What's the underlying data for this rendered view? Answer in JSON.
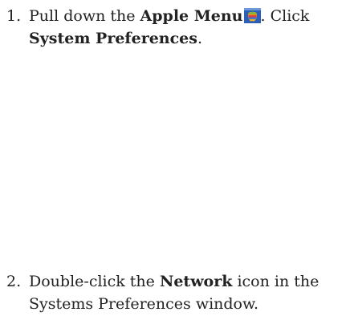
{
  "steps": [
    {
      "number": "1.",
      "line1_prefix": "Pull down the ",
      "line1_bold": "Apple Menu",
      "line1_suffix": ". Click",
      "line2_bold": "System Preferences",
      "line2_suffix": ".",
      "icon": "apple-menu-icon"
    },
    {
      "number": "2.",
      "line1_prefix": "Double-click the ",
      "line1_bold": "Network",
      "line1_suffix": " icon in the",
      "line2_text": "Systems Preferences window."
    }
  ]
}
